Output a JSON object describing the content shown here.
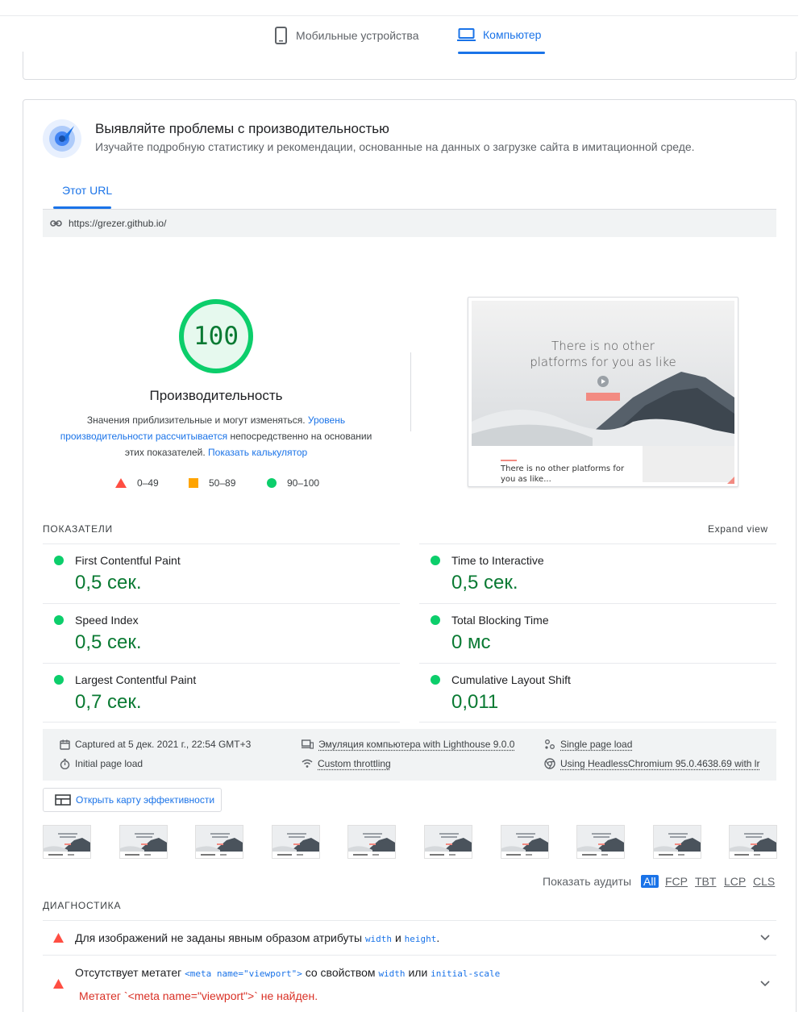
{
  "device_tabs": {
    "mobile_label": "Мобильные устройства",
    "desktop_label": "Компьютер"
  },
  "hero": {
    "title": "Выявляйте проблемы с производительностью",
    "subtitle": "Изучайте подробную статистику и рекомендации, основанные на данных о загрузке сайта в имитационной среде."
  },
  "url_tabs": {
    "active_label": "Этот URL"
  },
  "url_bar": {
    "url": "https://grezer.github.io/"
  },
  "score": {
    "value": "100",
    "fraction": 1.0,
    "title": "Производительность",
    "desc_1": "Значения приблизительные и могут изменяться. ",
    "desc_link_1": "Уровень производительности рассчитывается",
    "desc_2": " непосредственно на основании этих показателей. ",
    "desc_link_2": "Показать калькулятор"
  },
  "legend": [
    {
      "range": "0–49",
      "color": "#ff4e42",
      "shape": "triangle"
    },
    {
      "range": "50–89",
      "color": "#ffa400",
      "shape": "square"
    },
    {
      "range": "90–100",
      "color": "#0cce6b",
      "shape": "circle"
    }
  ],
  "screenshot": {
    "headline_1": "There is no other",
    "headline_2": "platforms for you as like",
    "caption_1": "There is no other platforms for",
    "caption_2": "you as like..."
  },
  "metrics_section": {
    "label": "ПОКАЗАТЕЛИ",
    "expand_label": "Expand view",
    "items": [
      {
        "name": "First Contentful Paint",
        "value": "0,5 сек."
      },
      {
        "name": "Time to Interactive",
        "value": "0,5 сек."
      },
      {
        "name": "Speed Index",
        "value": "0,5 сек."
      },
      {
        "name": "Total Blocking Time",
        "value": "0 мс"
      },
      {
        "name": "Largest Contentful Paint",
        "value": "0,7 сек."
      },
      {
        "name": "Cumulative Layout Shift",
        "value": "0,011"
      }
    ]
  },
  "run_info": {
    "captured": "Captured at 5 дек. 2021 г., 22:54 GMT+3",
    "initial_load": "Initial page load",
    "emulation": "Эмуляция компьютера with Lighthouse 9.0.0",
    "throttling": "Custom throttling",
    "single_load": "Single page load",
    "browser": "Using HeadlessChromium 95.0.4638.69 with lr"
  },
  "treemap": {
    "label": "Открыть карту эффективности"
  },
  "filmstrip_count": 10,
  "audits_filter": {
    "label": "Показать аудиты",
    "options": [
      "All",
      "FCP",
      "TBT",
      "LCP",
      "CLS"
    ],
    "active": "All"
  },
  "diagnostics": {
    "label": "ДИАГНОСТИКА",
    "item1_text_a": "Для изображений не заданы явным образом атрибуты ",
    "item1_code_a": "width",
    "item1_text_b": " и ",
    "item1_code_b": "height",
    "item1_text_c": ".",
    "item2_text_a": "Отсутствует метатег ",
    "item2_code_a": "<meta name=\"viewport\">",
    "item2_text_b": " со свойством ",
    "item2_code_b": "width",
    "item2_text_c": " или ",
    "item2_code_c": "initial-scale",
    "item2_error": "Метатег `<meta name=\"viewport\">` не найден."
  },
  "colors": {
    "accent": "#1a73e8",
    "pass": "#0cce6b",
    "pass_text": "#0a7a33",
    "fail": "#ff4e42",
    "average": "#ffa400"
  }
}
